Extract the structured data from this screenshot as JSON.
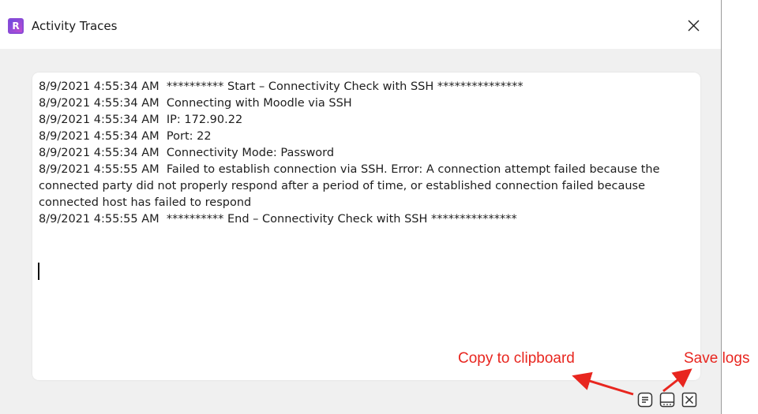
{
  "window": {
    "app_icon_letter": "R",
    "title": "Activity Traces"
  },
  "log": {
    "lines": [
      "8/9/2021 4:55:34 AM  ********** Start – Connectivity Check with SSH ***************",
      "8/9/2021 4:55:34 AM  Connecting with Moodle via SSH",
      "8/9/2021 4:55:34 AM  IP: 172.90.22",
      "8/9/2021 4:55:34 AM  Port: 22",
      "8/9/2021 4:55:34 AM  Connectivity Mode: Password",
      "8/9/2021 4:55:55 AM  Failed to establish connection via SSH. Error: A connection attempt failed because the connected party did not properly respond after a period of time, or established connection failed because connected host has failed to respond",
      "8/9/2021 4:55:55 AM  ********** End – Connectivity Check with SSH ***************"
    ]
  },
  "annotations": {
    "copy_label": "Copy to clipboard",
    "save_label": "Save logs",
    "color": "#e8261f"
  },
  "toolbar": {
    "buttons": [
      {
        "icon": "copy-to-clipboard-icon"
      },
      {
        "icon": "save-logs-icon"
      },
      {
        "icon": "close-box-icon"
      }
    ]
  }
}
